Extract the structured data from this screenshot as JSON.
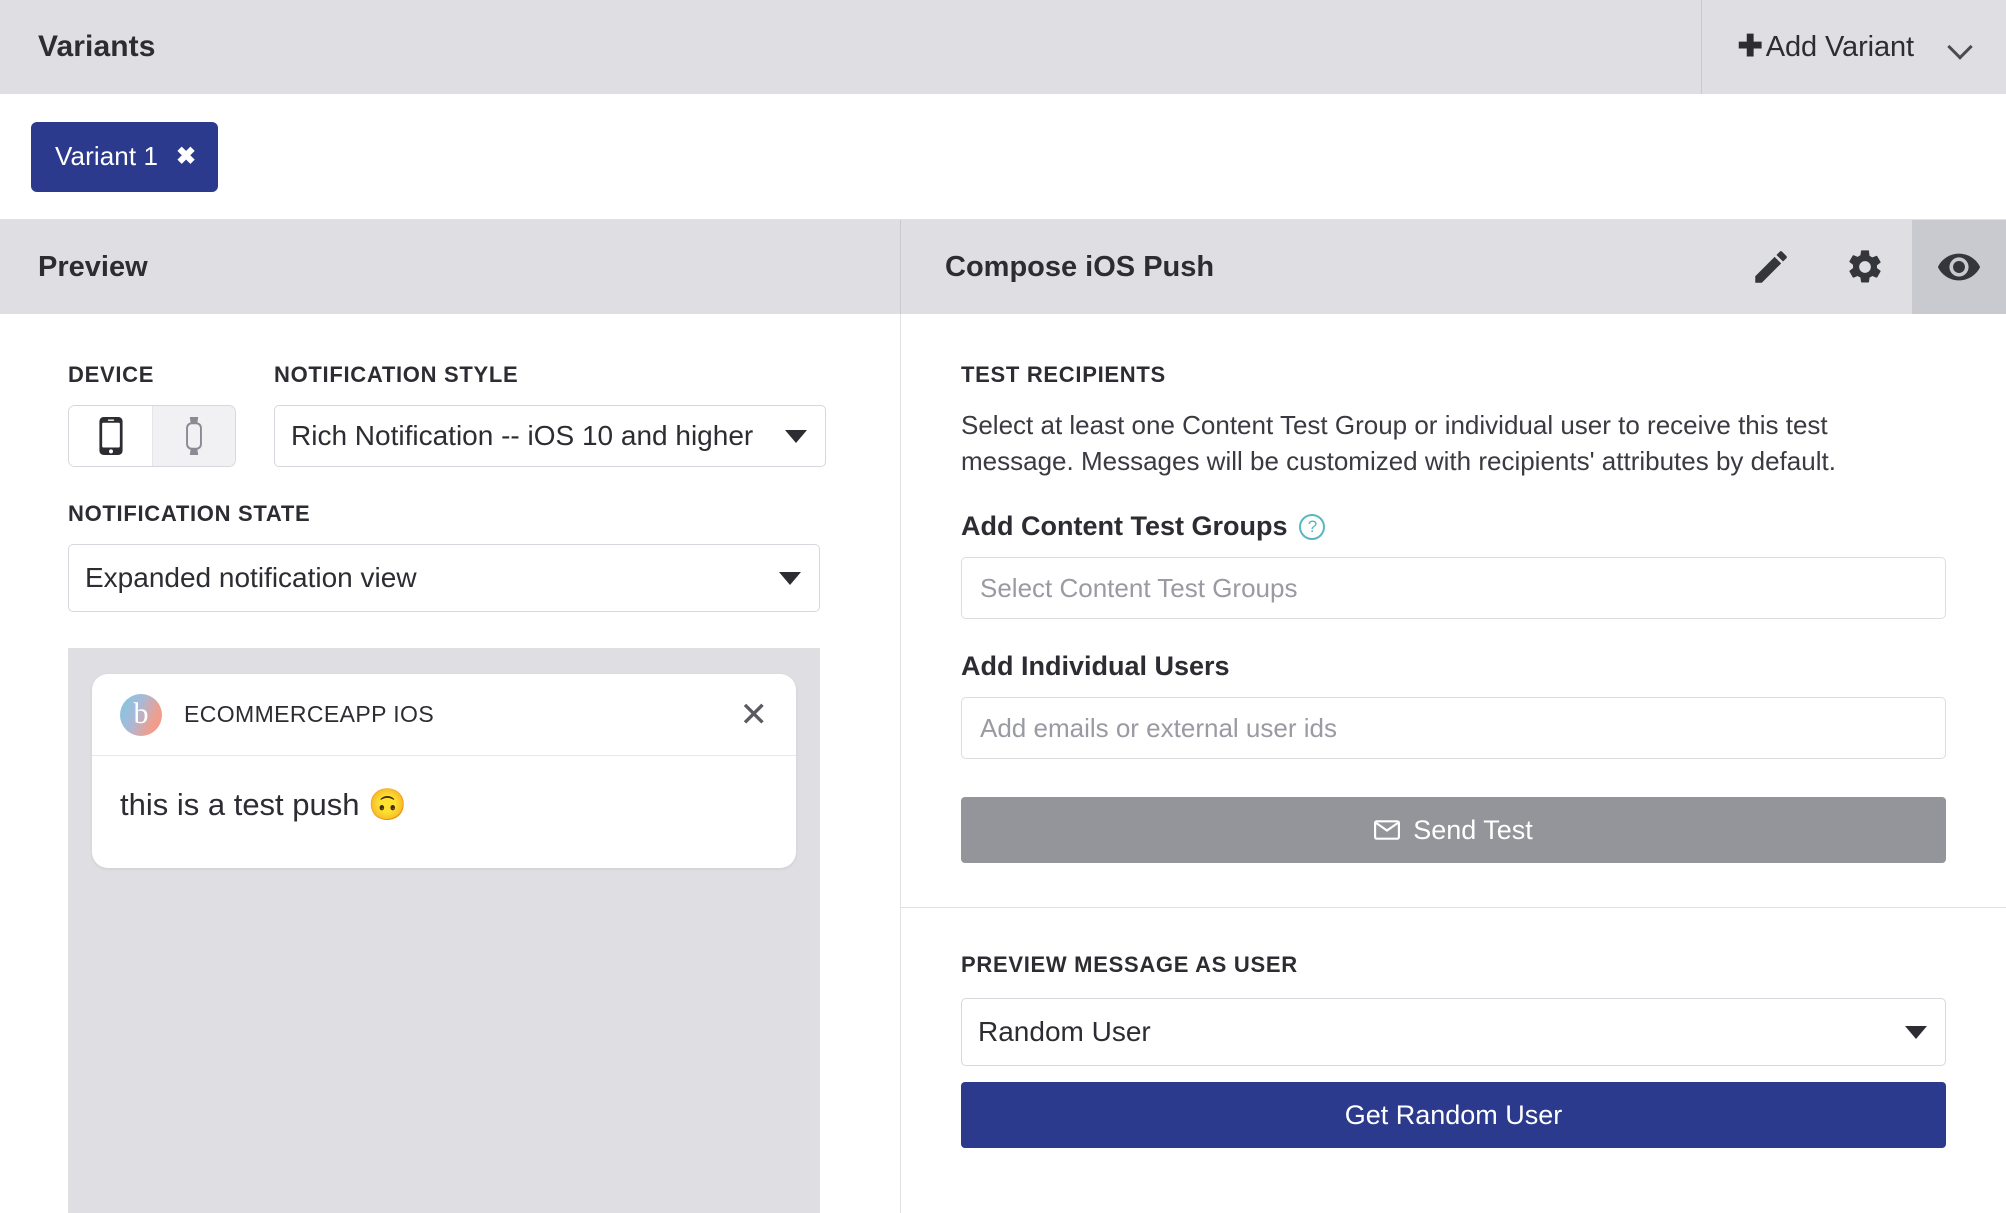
{
  "variants_header": {
    "title": "Variants",
    "add_variant_label": "Add Variant",
    "add_variant_plus": "✚",
    "add_variant_caret_icon": "chevron-down-icon"
  },
  "variant_tabs": [
    {
      "label": "Variant 1",
      "close_glyph": "✖",
      "active": true
    }
  ],
  "split_header": {
    "left_title": "Preview",
    "right_title": "Compose iOS Push",
    "icons": [
      {
        "name": "pencil-icon",
        "active": false
      },
      {
        "name": "gear-icon",
        "active": false
      },
      {
        "name": "eye-icon",
        "active": true
      }
    ]
  },
  "preview_pane": {
    "device_label": "DEVICE",
    "devices": [
      {
        "name": "phone",
        "icon": "phone-icon",
        "selected": true
      },
      {
        "name": "watch",
        "icon": "watch-icon",
        "selected": false
      }
    ],
    "notification_style_label": "NOTIFICATION STYLE",
    "notification_style_value": "Rich Notification -- iOS 10 and higher",
    "notification_state_label": "NOTIFICATION STATE",
    "notification_state_value": "Expanded notification view",
    "push_preview": {
      "app_icon_glyph": "b",
      "app_name": "ECOMMERCEAPP IOS",
      "close_glyph": "✕",
      "message": "this is a test push 🙃"
    }
  },
  "compose_pane": {
    "test_recipients_label": "TEST RECIPIENTS",
    "test_recipients_desc": "Select at least one Content Test Group or individual user to receive this test message. Messages will be customized with recipients' attributes by default.",
    "content_test_groups_label": "Add Content Test Groups",
    "content_test_groups_help": "?",
    "content_test_groups_placeholder": "Select Content Test Groups",
    "content_test_groups_value": "",
    "individual_users_label": "Add Individual Users",
    "individual_users_placeholder": "Add emails or external user ids",
    "individual_users_value": "",
    "send_test_label": "Send Test",
    "send_test_icon": "envelope-icon",
    "preview_as_user_label": "PREVIEW MESSAGE AS USER",
    "preview_as_user_value": "Random User",
    "get_random_user_label": "Get Random User"
  },
  "colors": {
    "brand_blue": "#2b3a8c",
    "header_grey": "#dedee3",
    "disabled_grey": "#94949b",
    "help_teal": "#5bb7bf"
  }
}
